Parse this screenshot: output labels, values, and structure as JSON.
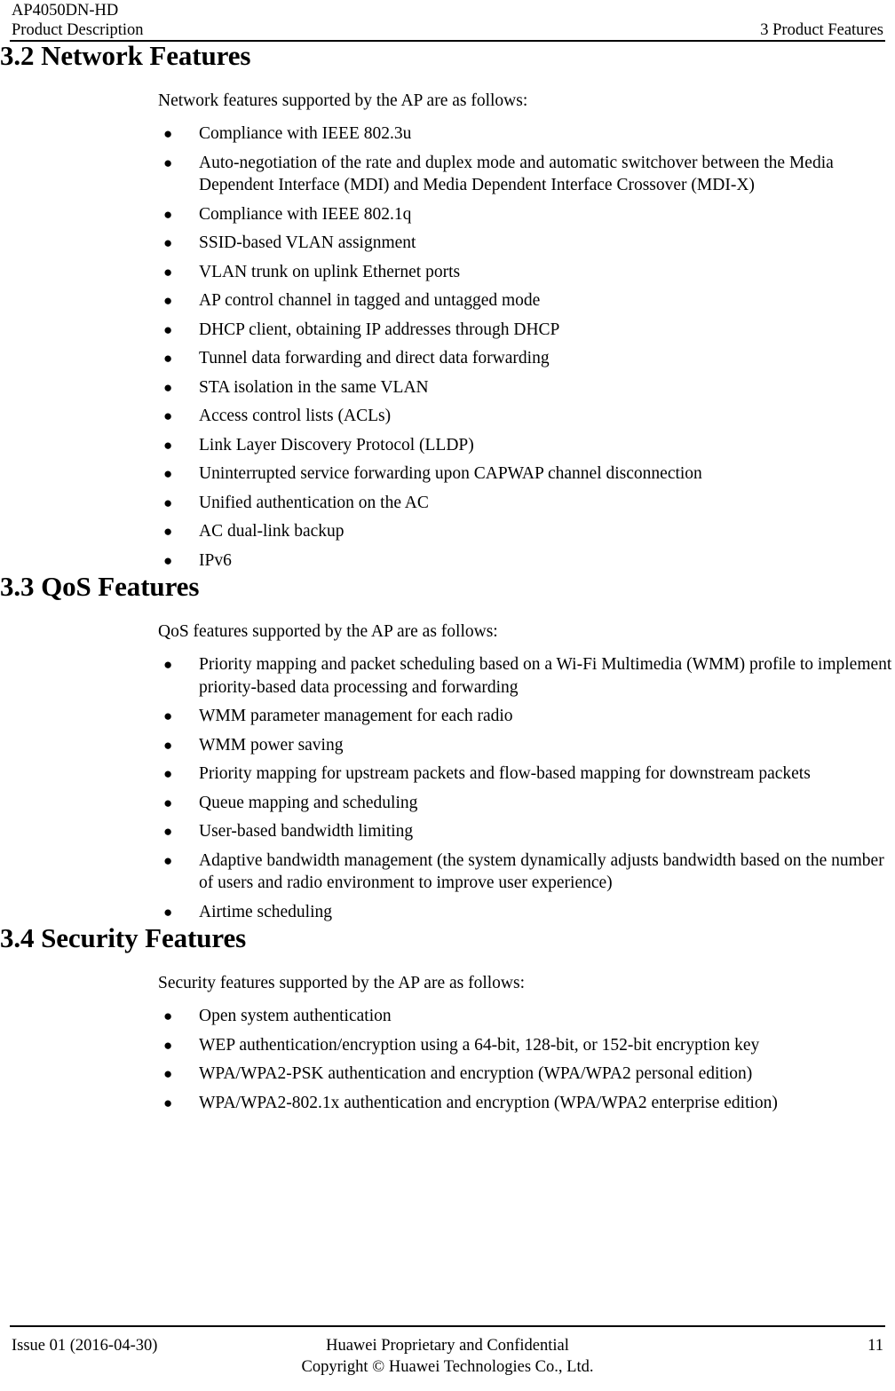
{
  "header": {
    "left_line1": "AP4050DN-HD",
    "left_line2": "Product Description",
    "right": "3 Product Features"
  },
  "sections": [
    {
      "heading": "3.2 Network Features",
      "lead": "Network features supported by the AP are as follows:",
      "bullets": [
        "Compliance with IEEE 802.3u",
        "Auto-negotiation of the rate and duplex mode and automatic switchover between the Media Dependent Interface (MDI) and Media Dependent Interface Crossover (MDI-X)",
        "Compliance with IEEE 802.1q",
        "SSID-based VLAN assignment",
        "VLAN trunk on uplink Ethernet ports",
        "AP control channel in tagged and untagged mode",
        "DHCP client, obtaining IP addresses through DHCP",
        "Tunnel data forwarding and direct data forwarding",
        "STA isolation in the same VLAN",
        "Access control lists (ACLs)",
        "Link Layer Discovery Protocol (LLDP)",
        "Uninterrupted service forwarding upon CAPWAP channel disconnection",
        "Unified authentication on the AC",
        "AC dual-link backup",
        "IPv6"
      ]
    },
    {
      "heading": "3.3 QoS Features",
      "lead": "QoS features supported by the AP are as follows:",
      "bullets": [
        "Priority mapping and packet scheduling based on a Wi-Fi Multimedia (WMM) profile to implement priority-based data processing and forwarding",
        "WMM parameter management for each radio",
        "WMM power saving",
        "Priority mapping for upstream packets and flow-based mapping for downstream packets",
        "Queue mapping and scheduling",
        "User-based bandwidth limiting",
        "Adaptive bandwidth management (the system dynamically adjusts bandwidth based on the number of users and radio environment to improve user experience)",
        "Airtime scheduling"
      ]
    },
    {
      "heading": "3.4 Security Features",
      "lead": "Security features supported by the AP are as follows:",
      "bullets": [
        "Open system authentication",
        "WEP authentication/encryption using a 64-bit, 128-bit, or 152-bit encryption key",
        "WPA/WPA2-PSK authentication and encryption (WPA/WPA2 personal edition)",
        "WPA/WPA2-802.1x authentication and encryption (WPA/WPA2 enterprise edition)"
      ]
    }
  ],
  "bullet_glyph": "●",
  "footer": {
    "left": "Issue 01 (2016-04-30)",
    "center_line1": "Huawei Proprietary and Confidential",
    "center_line2": "Copyright © Huawei Technologies Co., Ltd.",
    "page_number": "11"
  }
}
